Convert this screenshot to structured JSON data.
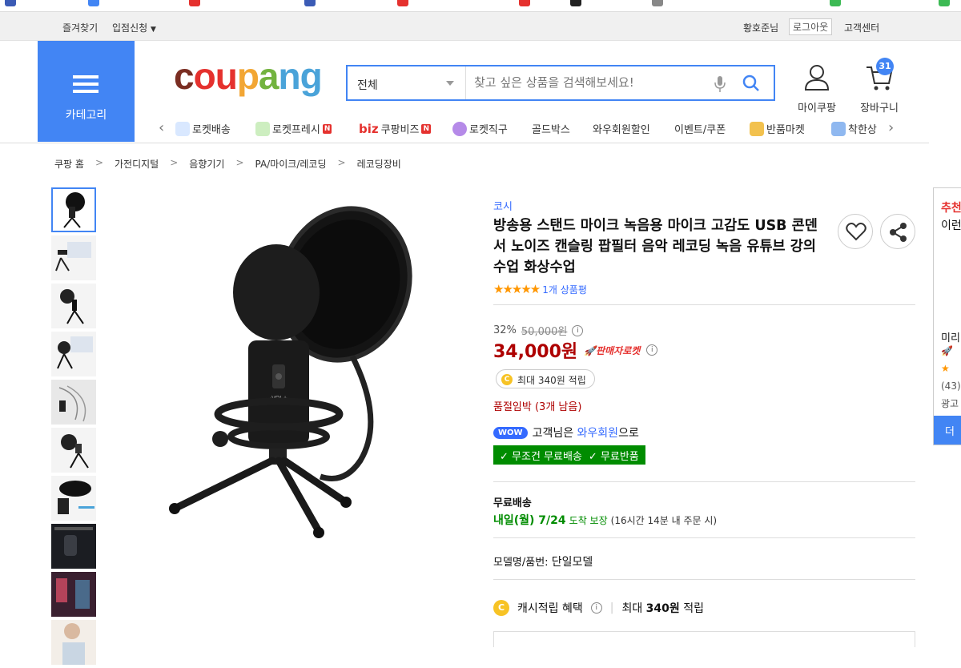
{
  "top_bar": {
    "favorites": "즐겨찾기",
    "seller_apply": "입점신청",
    "user_name": "황호준",
    "user_suffix": "님",
    "logout": "로그아웃",
    "customer_center": "고객센터"
  },
  "header": {
    "category_label": "카테고리",
    "logo": "coupang",
    "search": {
      "scope": "전체",
      "placeholder": "찾고 싶은 상품을 검색해보세요!"
    },
    "my_coupang": "마이쿠팡",
    "cart": "장바구니",
    "cart_count": "31"
  },
  "nav": [
    {
      "label": "로켓배송",
      "icon": "rocket-icon",
      "badge": ""
    },
    {
      "label": "로켓프레시",
      "icon": "rocket-fresh-icon",
      "badge": "N"
    },
    {
      "label": "쿠팡비즈",
      "icon": "biz-icon",
      "badge": "N",
      "prefix": "biz"
    },
    {
      "label": "로켓직구",
      "icon": "globe-icon",
      "badge": ""
    },
    {
      "label": "골드박스",
      "icon": "",
      "badge": ""
    },
    {
      "label": "와우회원할인",
      "icon": "",
      "badge": ""
    },
    {
      "label": "이벤트/쿠폰",
      "icon": "",
      "badge": ""
    },
    {
      "label": "반품마켓",
      "icon": "return-market-icon",
      "badge": ""
    },
    {
      "label": "착한상",
      "icon": "good-shop-icon",
      "badge": ""
    }
  ],
  "breadcrumb": [
    "쿠팡 홈",
    "가전디지털",
    "음향기기",
    "PA/마이크/레코딩",
    "레코딩장비"
  ],
  "product": {
    "brand": "코시",
    "title": "방송용 스탠드 마이크 녹음용 마이크 고감도 USB 콘덴서 노이즈 캔슬링 팝필터 음악 레코딩 녹음 유튜브 강의 수업 화상수업",
    "rating_count": "1개 상품평",
    "discount_rate": "32%",
    "original_price": "50,000원",
    "price": "34,000원",
    "rocket_badge": "판매자로켓",
    "cash_pill": "최대 340원 적립",
    "stock": "품절임박 (3개 남음)",
    "wow_tag": "WOW",
    "wow_text_1": "고객님은",
    "wow_link": "와우회원",
    "wow_text_2": "으로",
    "free_ship": "무조건 무료배송",
    "free_return": "무료반품",
    "shipping_label": "무료배송",
    "ship_date": "내일(월) 7/24",
    "ship_guarantee": "도착 보장",
    "ship_note": "(16시간 14분 내 주문 시)",
    "model_label": "모델명/품번:",
    "model_value": "단일모델",
    "cash_benefit_label": "캐시적립 혜택",
    "cash_benefit_value_pre": "최대",
    "cash_benefit_amount": "340원",
    "cash_benefit_value_post": "적립"
  },
  "rec_panel": {
    "t1": "추천",
    "t2": "이런",
    "l1": "미리",
    "l2": "(43)",
    "l3": "광고",
    "more": "더"
  },
  "colors": {
    "accent": "#4285f4",
    "price_red": "#ae0000",
    "link_blue": "#346aff",
    "green": "#008c00"
  }
}
